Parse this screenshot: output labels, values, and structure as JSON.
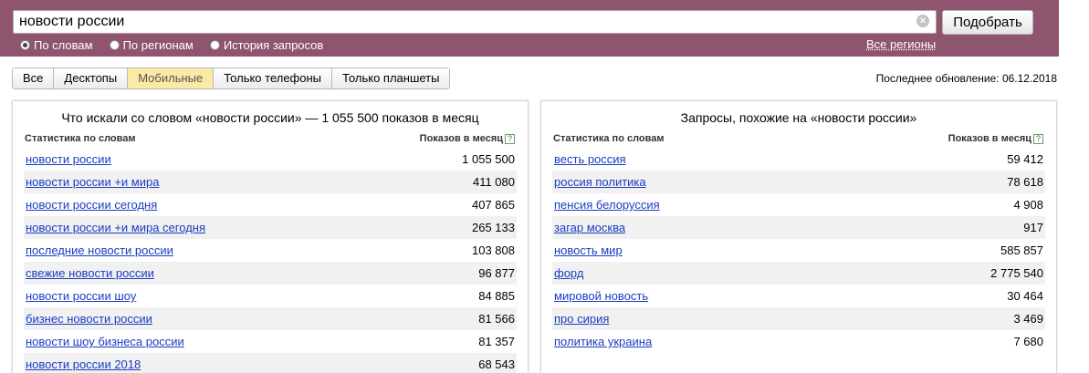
{
  "search": {
    "query": "новости россии",
    "submit_label": "Подобрать",
    "clear_glyph": "×",
    "modes": [
      {
        "label": "По словам",
        "checked": true
      },
      {
        "label": "По регионам",
        "checked": false
      },
      {
        "label": "История запросов",
        "checked": false
      }
    ],
    "regions_label": "Все регионы"
  },
  "device_tabs": [
    {
      "label": "Все",
      "active": false
    },
    {
      "label": "Десктопы",
      "active": false
    },
    {
      "label": "Мобильные",
      "active": true
    },
    {
      "label": "Только телефоны",
      "active": false
    },
    {
      "label": "Только планшеты",
      "active": false
    }
  ],
  "last_update": "Последнее обновление: 06.12.2018",
  "left_panel": {
    "title": "Что искали со словом «новости россии» — 1 055 500 показов в месяц",
    "col_phrase": "Статистика по словам",
    "col_count": "Показов в месяц",
    "help_glyph": "?",
    "rows": [
      {
        "phrase": "новости россии",
        "count": "1 055 500"
      },
      {
        "phrase": "новости россии +и мира",
        "count": "411 080"
      },
      {
        "phrase": "новости россии сегодня",
        "count": "407 865"
      },
      {
        "phrase": "новости россии +и мира сегодня",
        "count": "265 133"
      },
      {
        "phrase": "последние новости россии",
        "count": "103 808"
      },
      {
        "phrase": "свежие новости россии",
        "count": "96 877"
      },
      {
        "phrase": "новости россии шоу",
        "count": "84 885"
      },
      {
        "phrase": "бизнес новости россии",
        "count": "81 566"
      },
      {
        "phrase": "новости шоу бизнеса россии",
        "count": "81 357"
      },
      {
        "phrase": "новости россии 2018",
        "count": "68 543"
      }
    ]
  },
  "right_panel": {
    "title": "Запросы, похожие на «новости россии»",
    "col_phrase": "Статистика по словам",
    "col_count": "Показов в месяц",
    "help_glyph": "?",
    "rows": [
      {
        "phrase": "весть россия",
        "count": "59 412"
      },
      {
        "phrase": "россия политика",
        "count": "78 618"
      },
      {
        "phrase": "пенсия белоруссия",
        "count": "4 908"
      },
      {
        "phrase": "загар москва",
        "count": "917"
      },
      {
        "phrase": "новость мир",
        "count": "585 857"
      },
      {
        "phrase": "форд",
        "count": "2 775 540"
      },
      {
        "phrase": "мировой новость",
        "count": "30 464"
      },
      {
        "phrase": "про сирия",
        "count": "3 469"
      },
      {
        "phrase": "политика украина",
        "count": "7 680"
      }
    ]
  },
  "colors": {
    "header_bg": "#8f546e",
    "link": "#1a3dc1",
    "active_tab": "#fbe9a6",
    "row_alt": "#f1f1f1"
  }
}
